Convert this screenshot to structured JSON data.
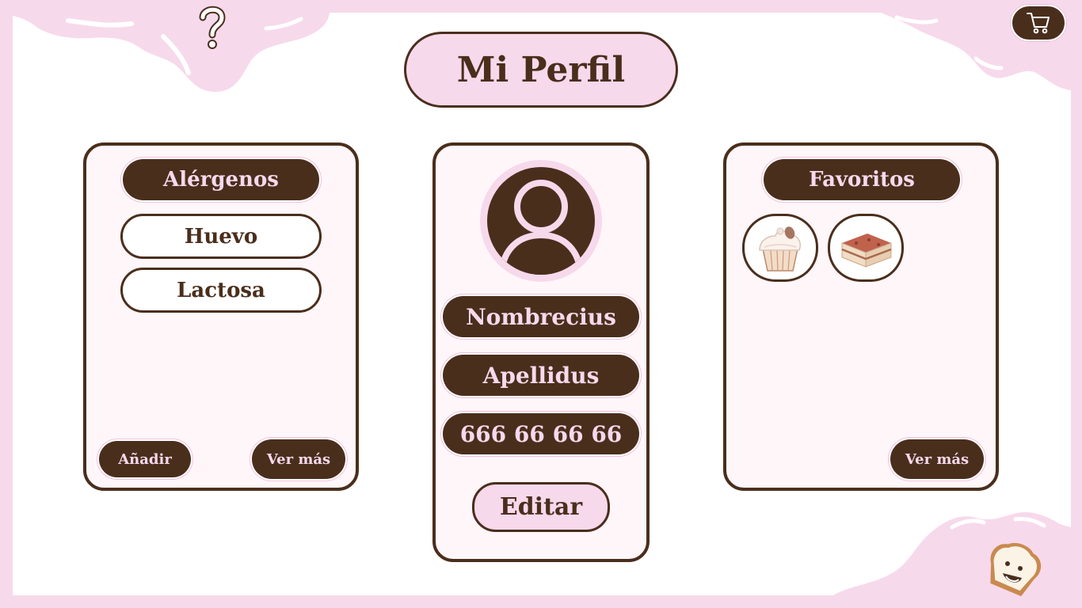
{
  "header": {
    "title": "Mi Perfil"
  },
  "icons": {
    "help": "question-mark-icon",
    "cart": "shopping-cart-icon",
    "avatar": "user-avatar-icon",
    "mascot": "toast-mascot-icon"
  },
  "colors": {
    "brown": "#4a2e1c",
    "pink": "#f7d9ec",
    "white": "#ffffff"
  },
  "allergens": {
    "heading": "Alérgenos",
    "items": [
      "Huevo",
      "Lactosa"
    ],
    "add_label": "Añadir",
    "more_label": "Ver más"
  },
  "profile": {
    "name": "Nombrecius",
    "surname": "Apellidus",
    "phone": "666 66 66 66",
    "edit_label": "Editar"
  },
  "favorites": {
    "heading": "Favoritos",
    "items": [
      "cupcake",
      "tiramisu"
    ],
    "more_label": "Ver más"
  }
}
